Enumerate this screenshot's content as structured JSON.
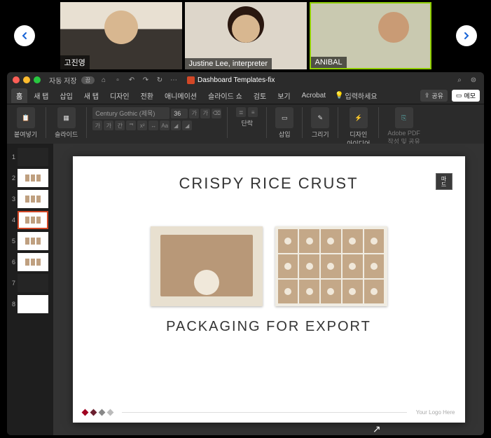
{
  "video": {
    "participants": [
      {
        "name": "고진영",
        "active": false
      },
      {
        "name": "Justine Lee, interpreter",
        "active": false
      },
      {
        "name": "ANIBAL",
        "active": true
      }
    ]
  },
  "titlebar": {
    "autosave_label": "자동 저장",
    "autosave_state": "끔",
    "filename": "Dashboard Templates-fix"
  },
  "ribbon": {
    "tabs": [
      "홈",
      "새 탭",
      "삽입",
      "새 탭",
      "디자인",
      "전환",
      "애니메이션",
      "슬라이드 쇼",
      "검토",
      "보기",
      "Acrobat"
    ],
    "active_tab_index": 0,
    "search_placeholder": "입력하세요",
    "share_label": "공유",
    "memo_label": "메모"
  },
  "toolbar": {
    "groups": {
      "paste": "붙여넣기",
      "slide": "슬라이드",
      "paragraph": "단락",
      "insert": "삽입",
      "draw": "그리기",
      "design_ideas": "디자인\n아이디어",
      "adobe": "Adobe PDF\n작성 및 공유"
    },
    "font_name": "Century Gothic (제목)",
    "font_size": "36"
  },
  "thumbnails": {
    "count": 8,
    "selected": 4,
    "dark_indices": [
      1,
      7
    ]
  },
  "slide": {
    "title": "CRISPY RICE CRUST",
    "subtitle": "PACKAGING FOR EXPORT",
    "badge": "마드",
    "logo_text": "Your Logo Here"
  }
}
